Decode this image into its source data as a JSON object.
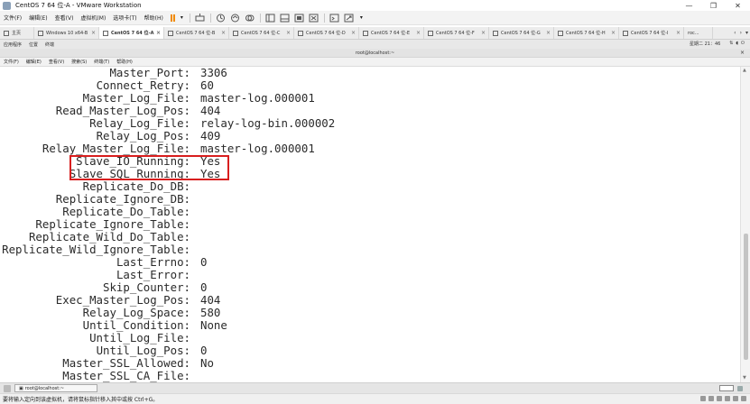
{
  "window": {
    "title": "CentOS 7 64 位-A - VMware Workstation",
    "controls": [
      "—",
      "❐",
      "✕"
    ]
  },
  "menu": {
    "items": [
      "文件(F)",
      "编辑(E)",
      "查看(V)",
      "虚拟机(M)",
      "选项卡(T)",
      "帮助(H)"
    ]
  },
  "tabs": [
    {
      "label": "主页"
    },
    {
      "label": "Windows 10 x64-B"
    },
    {
      "label": "CentOS 7 64 位-A"
    },
    {
      "label": "CentOS 7 64 位-B"
    },
    {
      "label": "CentOS 7 64 位-C"
    },
    {
      "label": "CentOS 7 64 位-D"
    },
    {
      "label": "CentOS 7 64 位-E"
    },
    {
      "label": "CentOS 7 64 位-F"
    },
    {
      "label": "CentOS 7 64 位-G"
    },
    {
      "label": "CentOS 7 64 位-H"
    },
    {
      "label": "CentOS 7 64 位-I"
    },
    {
      "label": "roc..."
    }
  ],
  "tab_close": "×",
  "guest_panel": {
    "applications": "应用程序",
    "places": "位置",
    "terminal": "终端",
    "clock": "星期二 21：46"
  },
  "terminal_window": {
    "title": "root@localhost:~",
    "close": "×",
    "menu": [
      "文件(F)",
      "编辑(E)",
      "查看(V)",
      "搜索(S)",
      "终端(T)",
      "帮助(H)"
    ]
  },
  "terminal": {
    "rows": [
      {
        "key": "Master_Port:",
        "value": "3306"
      },
      {
        "key": "Connect_Retry:",
        "value": "60"
      },
      {
        "key": "Master_Log_File:",
        "value": "master-log.000001"
      },
      {
        "key": "Read_Master_Log_Pos:",
        "value": "404"
      },
      {
        "key": "Relay_Log_File:",
        "value": "relay-log-bin.000002"
      },
      {
        "key": "Relay_Log_Pos:",
        "value": "409"
      },
      {
        "key": "Relay_Master_Log_File:",
        "value": "master-log.000001"
      },
      {
        "key": "Slave_IO_Running:",
        "value": "Yes"
      },
      {
        "key": "Slave_SQL_Running:",
        "value": "Yes"
      },
      {
        "key": "Replicate_Do_DB:",
        "value": ""
      },
      {
        "key": "Replicate_Ignore_DB:",
        "value": ""
      },
      {
        "key": "Replicate_Do_Table:",
        "value": ""
      },
      {
        "key": "Replicate_Ignore_Table:",
        "value": ""
      },
      {
        "key": "Replicate_Wild_Do_Table:",
        "value": ""
      },
      {
        "key": "Replicate_Wild_Ignore_Table:",
        "value": ""
      },
      {
        "key": "Last_Errno:",
        "value": "0"
      },
      {
        "key": "Last_Error:",
        "value": ""
      },
      {
        "key": "Skip_Counter:",
        "value": "0"
      },
      {
        "key": "Exec_Master_Log_Pos:",
        "value": "404"
      },
      {
        "key": "Relay_Log_Space:",
        "value": "580"
      },
      {
        "key": "Until_Condition:",
        "value": "None"
      },
      {
        "key": "Until_Log_File:",
        "value": ""
      },
      {
        "key": "Until_Log_Pos:",
        "value": "0"
      },
      {
        "key": "Master_SSL_Allowed:",
        "value": "No"
      },
      {
        "key": "Master_SSL_CA_File:",
        "value": ""
      }
    ]
  },
  "taskbar": {
    "terminal_button": "root@localhost:~"
  },
  "statusbar": {
    "message": "要将输入定向到该虚拟机，请将鼠标指针移入其中或按 Ctrl+G。"
  },
  "colors": {
    "highlight": "#d81e1e",
    "pause": "#f08a00"
  }
}
